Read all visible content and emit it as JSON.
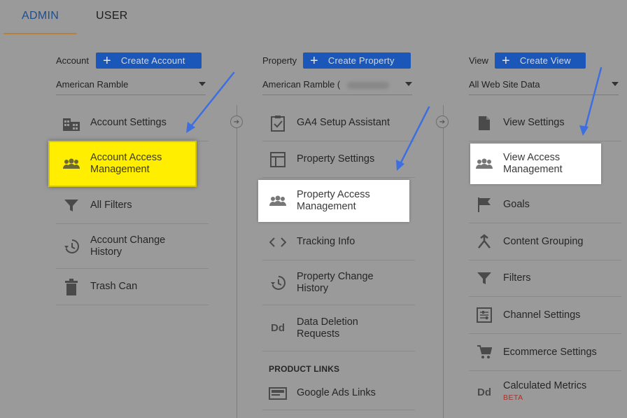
{
  "tabs": {
    "admin": "ADMIN",
    "user": "USER"
  },
  "account": {
    "label": "Account",
    "create_button": "Create Account",
    "selector": "American Ramble",
    "items": [
      {
        "label": "Account Settings",
        "icon": "building-icon"
      },
      {
        "label": "Account Access Management",
        "icon": "people-icon"
      },
      {
        "label": "All Filters",
        "icon": "filter-icon"
      },
      {
        "label": "Account Change History",
        "icon": "history-icon"
      },
      {
        "label": "Trash Can",
        "icon": "trash-icon"
      }
    ]
  },
  "property": {
    "label": "Property",
    "create_button": "Create Property",
    "selector": "American Ramble (",
    "items": [
      {
        "label": "GA4 Setup Assistant",
        "icon": "clipboard-check-icon"
      },
      {
        "label": "Property Settings",
        "icon": "layout-icon"
      },
      {
        "label": "Property Access Management",
        "icon": "people-icon"
      },
      {
        "label": "Tracking Info",
        "icon": "code-icon"
      },
      {
        "label": "Property Change History",
        "icon": "history-icon"
      },
      {
        "label": "Data Deletion Requests",
        "icon": "dd-icon"
      }
    ],
    "section_header": "PRODUCT LINKS",
    "product_links": [
      {
        "label": "Google Ads Links",
        "icon": "ads-icon"
      }
    ]
  },
  "view": {
    "label": "View",
    "create_button": "Create View",
    "selector": "All Web Site Data",
    "items": [
      {
        "label": "View Settings",
        "icon": "document-icon"
      },
      {
        "label": "View Access Management",
        "icon": "people-icon"
      },
      {
        "label": "Goals",
        "icon": "flag-icon"
      },
      {
        "label": "Content Grouping",
        "icon": "grouping-icon"
      },
      {
        "label": "Filters",
        "icon": "filter-icon"
      },
      {
        "label": "Channel Settings",
        "icon": "channel-icon"
      },
      {
        "label": "Ecommerce Settings",
        "icon": "cart-icon"
      },
      {
        "label": "Calculated Metrics",
        "icon": "dd-icon",
        "badge": "BETA"
      }
    ]
  },
  "colors": {
    "background": "#9a9a9a",
    "accent_blue": "#1a57b8",
    "highlight_yellow": "#ffee00",
    "highlight_white": "#ffffff",
    "annotation_arrow": "#3d6fe0",
    "beta_red": "#a3342d"
  }
}
